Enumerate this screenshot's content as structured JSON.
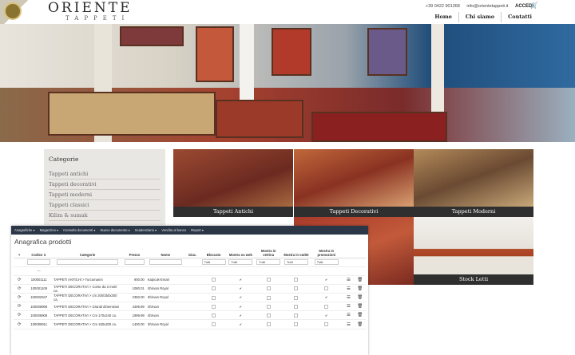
{
  "header": {
    "logo_title": "ORIENTE",
    "logo_subtitle": "TAPPETI",
    "phone": "+39 0422 901368",
    "email": "info@orientetappeti.it",
    "login": "ACCEDI",
    "nav": [
      "Home",
      "Chi siamo",
      "Contatti"
    ]
  },
  "sidebar": {
    "title": "Categorie",
    "items": [
      "Tappeti antichi",
      "Tappeti decorativi",
      "Tappeti moderni",
      "Tappeti classici",
      "Kilim & sumak"
    ]
  },
  "tiles": [
    "Tappeti Antichi",
    "Tappeti Decorativi",
    "Tappeti Moderni",
    "Stock Letti"
  ],
  "admin": {
    "menu": [
      "Anagrafiche ▾",
      "Magazzino ▾",
      "Consulta documenti ▾",
      "Nuovo documento ▾",
      "Scadenziario ▾",
      "Vendita al banco",
      "Report ▾"
    ],
    "page_title": "Anagrafica prodotti",
    "columns": [
      "Codice",
      "Categorie",
      "Prezzo",
      "Nome",
      "Giac.",
      "Bloccato",
      "Mostra su web",
      "Mostra in vetrina",
      "Mostra in outlet",
      "Mostra in promozioni"
    ],
    "filter_all": "Tutti",
    "filter_dash": "---",
    "rows": [
      {
        "code": "100001111",
        "cat": "TAPPETI ANTICHI > Turcomanni",
        "price": "900.00",
        "name": "Kapicuk-Ersari",
        "web": true,
        "promo": true
      },
      {
        "code": "100001109",
        "cat": "TAPPETI DECORATIVI > Corse da 3 metri ca.",
        "price": "1080.01",
        "name": "Shirvan Royal",
        "web": true,
        "promo": false
      },
      {
        "code": "100002947",
        "cat": "TAPPETI DECORATIVI > cm 200/250x300 ca.",
        "price": "2350.00",
        "name": "Shirvan Royal",
        "web": true,
        "promo": true
      },
      {
        "code": "100006908",
        "cat": "TAPPETI DECORATIVI > Grandi dimensioni",
        "price": "4499.99",
        "name": "Shirvan",
        "web": true,
        "promo": false
      },
      {
        "code": "100006908",
        "cat": "TAPPETI DECORATIVI > Cm 170x240 ca.",
        "price": "1999.99",
        "name": "Shirvan",
        "web": true,
        "promo": true
      },
      {
        "code": "100006911",
        "cat": "TAPPETI DECORATIVI > Cm 150x200 ca.",
        "price": "1400.00",
        "name": "Shirvan Royal",
        "web": true,
        "promo": false
      }
    ]
  }
}
